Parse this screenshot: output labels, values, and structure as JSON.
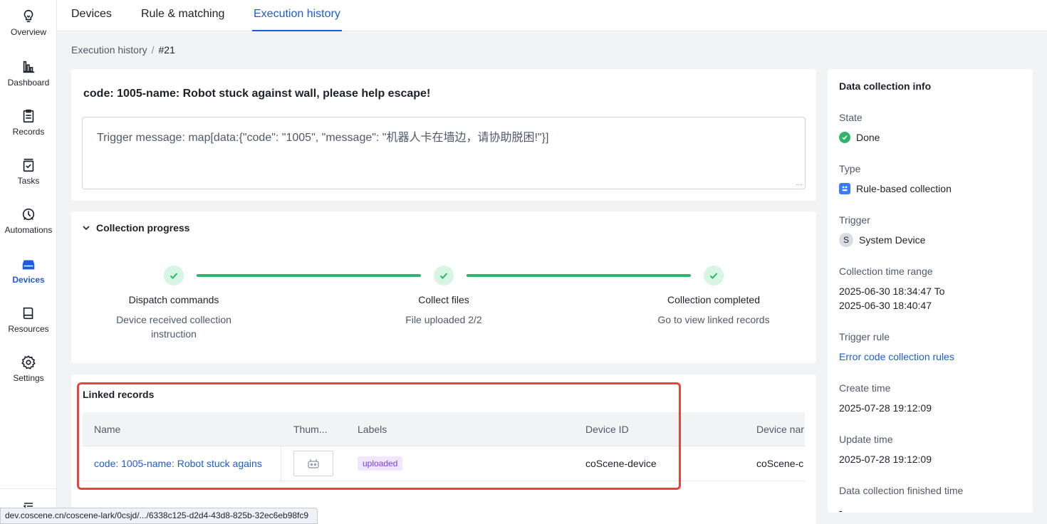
{
  "sidebar": {
    "items": [
      {
        "label": "Overview",
        "icon": "lightbulb-icon"
      },
      {
        "label": "Dashboard",
        "icon": "bar-chart-icon"
      },
      {
        "label": "Records",
        "icon": "clipboard-icon"
      },
      {
        "label": "Tasks",
        "icon": "task-check-icon"
      },
      {
        "label": "Automations",
        "icon": "automation-icon"
      },
      {
        "label": "Devices",
        "icon": "device-icon"
      },
      {
        "label": "Resources",
        "icon": "book-icon"
      },
      {
        "label": "Settings",
        "icon": "gear-icon"
      }
    ],
    "active": "Devices"
  },
  "tabs": [
    {
      "label": "Devices"
    },
    {
      "label": "Rule & matching"
    },
    {
      "label": "Execution history"
    }
  ],
  "active_tab": "Execution history",
  "breadcrumb": {
    "parent": "Execution history",
    "separator": "/",
    "current": "#21"
  },
  "main": {
    "title": "code: 1005-name: Robot stuck against wall, please help escape!",
    "trigger_message": "Trigger message: map[data:{\"code\": \"1005\", \"message\": \"机器人卡在墙边，请协助脱困!\"}]",
    "resize_handle": "..."
  },
  "progress": {
    "heading": "Collection progress",
    "steps": [
      {
        "title": "Dispatch commands",
        "desc": "Device received collection instruction"
      },
      {
        "title": "Collect files",
        "desc": "File uploaded 2/2"
      },
      {
        "title": "Collection completed",
        "desc": "Go to view linked records"
      }
    ]
  },
  "linked_records": {
    "heading": "Linked records",
    "columns": [
      "Name",
      "Thum...",
      "Labels",
      "Device ID",
      "Device nar"
    ],
    "rows": [
      {
        "name": "code: 1005-name: Robot stuck agains",
        "label": "uploaded",
        "device_id": "coScene-device",
        "device_name": "coScene-c"
      }
    ]
  },
  "info": {
    "heading": "Data collection info",
    "state_label": "State",
    "state_value": "Done",
    "type_label": "Type",
    "type_value": "Rule-based collection",
    "trigger_label": "Trigger",
    "trigger_avatar": "S",
    "trigger_value": "System Device",
    "range_label": "Collection time range",
    "range_start": "2025-06-30 18:34:47 To",
    "range_end": "2025-06-30 18:40:47",
    "rule_label": "Trigger rule",
    "rule_value": "Error code collection rules",
    "create_label": "Create time",
    "create_value": "2025-07-28 19:12:09",
    "update_label": "Update time",
    "update_value": "2025-07-28 19:12:09",
    "finished_label": "Data collection finished time",
    "finished_value": "-"
  },
  "status_url": "dev.coscene.cn/coscene-lark/0csjd/.../6338c125-d2d4-43d8-825b-32ec6eb98fc9",
  "colors": {
    "accent": "#1e5adb",
    "success": "#2fb56b",
    "highlight": "#e5453b",
    "tag_bg": "#f0e6ff",
    "tag_text": "#7a3ee0"
  }
}
